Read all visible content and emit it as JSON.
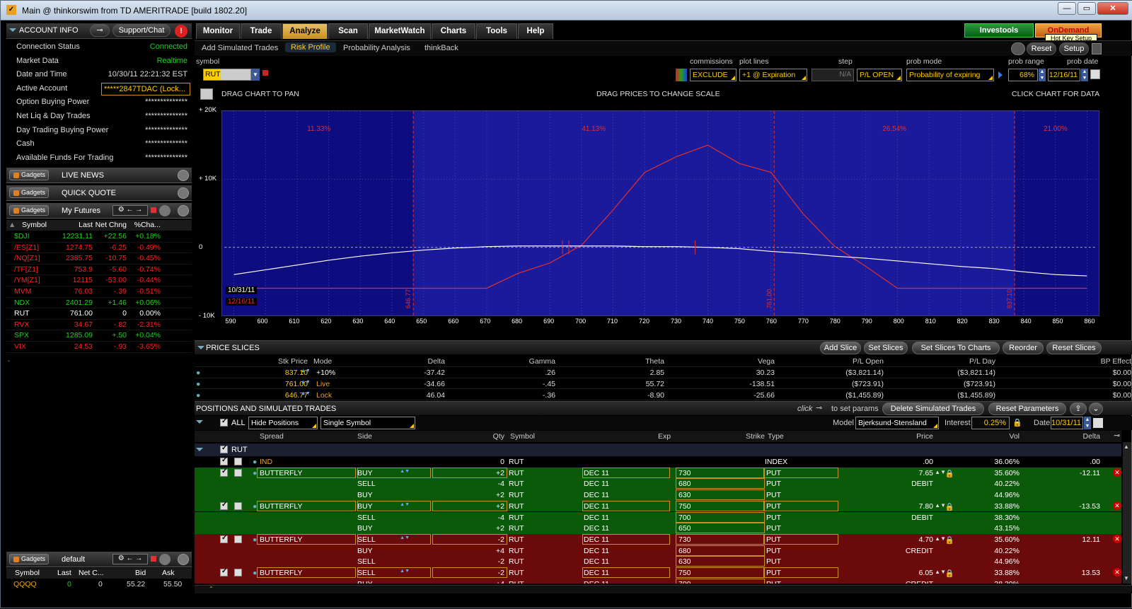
{
  "window": {
    "title": "Main @ thinkorswim from TD AMERITRADE [build 1802.20]",
    "min": "—",
    "max": "▭",
    "close": "✕"
  },
  "account": {
    "header": "ACCOUNT INFO",
    "support": "Support/Chat",
    "rows": [
      {
        "k": "Connection Status",
        "v": "Connected"
      },
      {
        "k": "Market Data",
        "v": "Realtime"
      },
      {
        "k": "Date and Time",
        "v": "10/30/11 22:21:32 EST"
      },
      {
        "k": "Active Account",
        "v": "*****2847TDAC (Lock..."
      },
      {
        "k": "Option Buying Power",
        "v": "**************"
      },
      {
        "k": "Net Liq & Day Trades",
        "v": "**************"
      },
      {
        "k": "Day Trading Buying Power",
        "v": "**************"
      },
      {
        "k": "Cash",
        "v": "**************"
      },
      {
        "k": "Available Funds For Trading",
        "v": "**************"
      }
    ]
  },
  "gadgets": {
    "label": "Gadgets",
    "live_news": "LIVE NEWS",
    "quick_quote": "QUICK QUOTE",
    "my_futures": "My Futures",
    "default": "default"
  },
  "futures": {
    "headers": [
      "Symbol",
      "Last",
      "Net Chng",
      "%Cha..."
    ],
    "rows": [
      {
        "s": "$DJI",
        "l": "12231.11",
        "n": "+22.56",
        "p": "+0.18%",
        "c": "g"
      },
      {
        "s": "/ES[Z1]",
        "l": "1274.75",
        "n": "-6.25",
        "p": "-0.49%",
        "c": "r"
      },
      {
        "s": "/NQ[Z1]",
        "l": "2385.75",
        "n": "-10.75",
        "p": "-0.45%",
        "c": "r"
      },
      {
        "s": "/TF[Z1]",
        "l": "753.9",
        "n": "-5.60",
        "p": "-0.74%",
        "c": "r"
      },
      {
        "s": "/YM[Z1]",
        "l": "12115",
        "n": "-53.00",
        "p": "-0.44%",
        "c": "r"
      },
      {
        "s": "MVM",
        "l": "76.03",
        "n": "-.39",
        "p": "-0.51%",
        "c": "r"
      },
      {
        "s": "NDX",
        "l": "2401.29",
        "n": "+1.46",
        "p": "+0.06%",
        "c": "g"
      },
      {
        "s": "RUT",
        "l": "761.00",
        "n": "0",
        "p": "0.00%",
        "c": "w"
      },
      {
        "s": "RVX",
        "l": "34.67",
        "n": "-.82",
        "p": "-2.31%",
        "c": "r"
      },
      {
        "s": "SPX",
        "l": "1285.09",
        "n": "+.50",
        "p": "+0.04%",
        "c": "g"
      },
      {
        "s": "VIX",
        "l": "24.53",
        "n": "-.93",
        "p": "-3.65%",
        "c": "r"
      }
    ]
  },
  "quote": {
    "headers": [
      "Symbol",
      "Last",
      "Net C...",
      "Bid",
      "Ask"
    ],
    "row": [
      "QQQQ",
      "0",
      "0",
      "55.22",
      "55.50"
    ]
  },
  "tabs": [
    "Monitor",
    "Trade",
    "Analyze",
    "Scan",
    "MarketWatch",
    "Charts",
    "Tools",
    "Help"
  ],
  "investools": "Investools",
  "ondemand": "OnDemand",
  "hotkey": "Hot Key Setup",
  "subtabs": [
    "Add Simulated Trades",
    "Risk Profile",
    "Probability Analysis",
    "thinkBack"
  ],
  "reset": "Reset",
  "setup": "Setup",
  "controls": {
    "symbol_label": "symbol",
    "symbol": "RUT",
    "commissions_label": "commissions",
    "commissions": "EXCLUDE",
    "plot_label": "plot lines",
    "plot": "+1 @ Expiration",
    "step_label": "step",
    "step": "N/A",
    "pl": "P/L OPEN",
    "prob_mode_label": "prob mode",
    "prob_mode": "Probability of expiring",
    "prob_range_label": "prob range",
    "prob_range": "68%",
    "prob_date_label": "prob date",
    "prob_date": "12/16/11"
  },
  "chart_text": {
    "drag_pan": "DRAG CHART TO PAN",
    "drag_prices": "DRAG PRICES TO CHANGE SCALE",
    "click": "CLICK CHART FOR DATA",
    "date1": "10/31/11",
    "date2": "12/16/11"
  },
  "chart_data": {
    "type": "line",
    "x": [
      590,
      600,
      610,
      620,
      630,
      640,
      650,
      660,
      670,
      680,
      690,
      700,
      710,
      720,
      730,
      740,
      750,
      760,
      770,
      780,
      790,
      800,
      810,
      820,
      830,
      840,
      850,
      860
    ],
    "y_ticks": [
      "+ 20K",
      "+ 10K",
      "0",
      "- 10K"
    ],
    "ylim": [
      -10000,
      20000
    ],
    "xlim": [
      587,
      863
    ],
    "series": [
      {
        "values": [
          -6000,
          -6000,
          -6000,
          -6000,
          -6000,
          -6000,
          -6000,
          -6000,
          -6000,
          -3800,
          -2300,
          300,
          5500,
          11000,
          13300,
          15000,
          12300,
          11000,
          5000,
          200,
          -2800,
          -6000,
          -6000,
          -6000,
          -6000,
          -6000,
          -6000,
          -6000
        ]
      },
      {
        "values": [
          -4000,
          -3300,
          -2600,
          -1900,
          -1300,
          -800,
          -400,
          -100,
          100,
          200,
          200,
          200,
          200,
          100,
          100,
          0,
          -200,
          -600,
          -900,
          -1300,
          -1600,
          -2000,
          -2400,
          -2800,
          -3100,
          -3600,
          -4000,
          -4200
        ]
      }
    ],
    "probabilities": [
      "11.33%",
      "41.13%",
      "26.54%",
      "21.00%"
    ],
    "prob_lines": [
      646.77,
      761.0,
      837.1
    ]
  },
  "price_slices": {
    "title": "PRICE SLICES",
    "buttons": [
      "Add Slice",
      "Set Slices",
      "Set Slices To Charts",
      "Reorder",
      "Reset Slices"
    ],
    "headers": [
      "Stk Price",
      "Mode",
      "Delta",
      "Gamma",
      "Theta",
      "Vega",
      "P/L Open",
      "P/L Day",
      "BP Effect"
    ],
    "rows": [
      [
        "837.10",
        "+10%",
        "-37.42",
        ".26",
        "2.85",
        "30.23",
        "($3,821.14)",
        "($3,821.14)",
        "$0.00"
      ],
      [
        "761.00",
        "Live",
        "-34.66",
        "-.45",
        "55.72",
        "-138.51",
        "($723.91)",
        "($723.91)",
        "$0.00"
      ],
      [
        "646.77",
        "Lock",
        "46.04",
        "-.36",
        "-8.90",
        "-25.66",
        "($1,455.89)",
        "($1,455.89)",
        "$0.00"
      ]
    ]
  },
  "positions": {
    "title": "POSITIONS AND SIMULATED TRADES",
    "click": "click",
    "to_set": "to set params",
    "delete": "Delete Simulated Trades",
    "reset": "Reset Parameters",
    "all": "ALL",
    "hide": "Hide Positions",
    "single": "Single Symbol",
    "model_label": "Model",
    "model": "Bjerksund-Stensland",
    "interest_label": "Interest",
    "interest": "0.25%",
    "date_label": "Date",
    "date": "10/31/11",
    "headers": [
      "Spread",
      "Side",
      "Qty",
      "Symbol",
      "Exp",
      "Strike",
      "Type",
      "Price",
      "Vol",
      "Delta"
    ],
    "group": "RUT",
    "ind": {
      "spread": "IND",
      "qty": "0",
      "sym": "RUT",
      "type": "INDEX",
      "price": ".00",
      "vol": "36.06%",
      "delta": ".00"
    },
    "trades": [
      {
        "bg": "g",
        "legs": [
          [
            "BUTTERFLY",
            "BUY",
            "+2",
            "RUT",
            "DEC 11",
            "730",
            "PUT",
            "7.65",
            "35.60%",
            "-12.11"
          ],
          [
            "",
            "SELL",
            "-4",
            "RUT",
            "DEC 11",
            "680",
            "PUT",
            "DEBIT",
            "40.22%",
            ""
          ],
          [
            "",
            "BUY",
            "+2",
            "RUT",
            "DEC 11",
            "630",
            "PUT",
            "",
            "44.96%",
            ""
          ]
        ]
      },
      {
        "bg": "g",
        "legs": [
          [
            "BUTTERFLY",
            "BUY",
            "+2",
            "RUT",
            "DEC 11",
            "750",
            "PUT",
            "7.80",
            "33.88%",
            "-13.53"
          ],
          [
            "",
            "SELL",
            "-4",
            "RUT",
            "DEC 11",
            "700",
            "PUT",
            "DEBIT",
            "38.30%",
            ""
          ],
          [
            "",
            "BUY",
            "+2",
            "RUT",
            "DEC 11",
            "650",
            "PUT",
            "",
            "43.15%",
            ""
          ]
        ]
      },
      {
        "bg": "r",
        "legs": [
          [
            "BUTTERFLY",
            "SELL",
            "-2",
            "RUT",
            "DEC 11",
            "730",
            "PUT",
            "4.70",
            "35.60%",
            "12.11"
          ],
          [
            "",
            "BUY",
            "+4",
            "RUT",
            "DEC 11",
            "680",
            "PUT",
            "CREDIT",
            "40.22%",
            ""
          ],
          [
            "",
            "SELL",
            "-2",
            "RUT",
            "DEC 11",
            "630",
            "PUT",
            "",
            "44.96%",
            ""
          ]
        ]
      },
      {
        "bg": "r",
        "legs": [
          [
            "BUTTERFLY",
            "SELL",
            "-2",
            "RUT",
            "DEC 11",
            "750",
            "PUT",
            "6.05",
            "33.88%",
            "13.53"
          ],
          [
            "",
            "BUY",
            "+4",
            "RUT",
            "DEC 11",
            "700",
            "PUT",
            "CREDIT",
            "38.30%",
            ""
          ]
        ]
      }
    ]
  }
}
